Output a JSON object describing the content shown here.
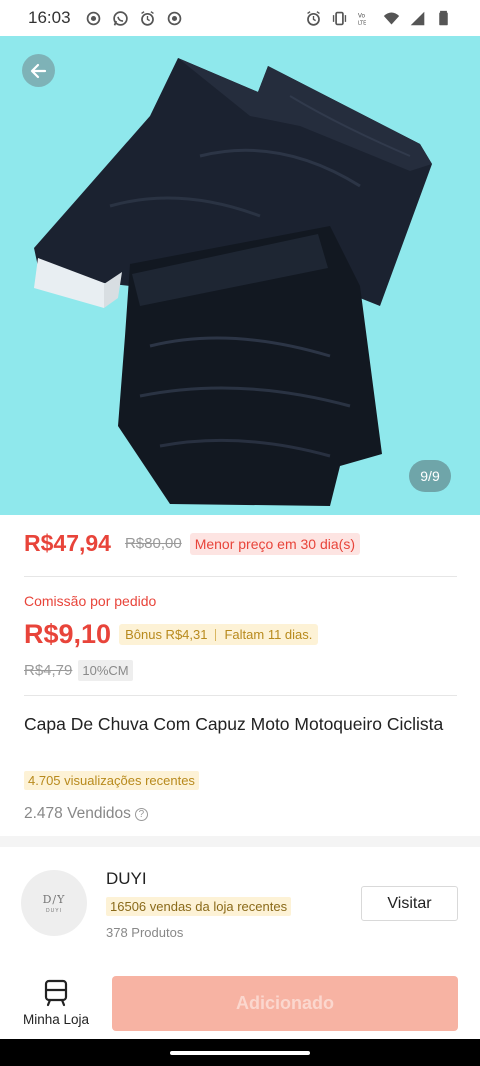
{
  "status_bar": {
    "time": "16:03"
  },
  "hero": {
    "image_counter": "9/9",
    "background_color": "#8fe8ec"
  },
  "price": {
    "current": "R$47,94",
    "original": "R$80,00",
    "badge": "Menor preço em 30 dia(s)"
  },
  "commission": {
    "label": "Comissão por pedido",
    "value": "R$9,10",
    "bonus": "Bônus R$4,31",
    "days_left": "Faltam 11 dias.",
    "old_value": "R$4,79",
    "rate_badge": "10%CM"
  },
  "product": {
    "title": "Capa De Chuva Com Capuz Moto Motoqueiro Ciclista",
    "views_badge": "4.705 visualizações recentes",
    "sold": "2.478 Vendidos"
  },
  "store": {
    "logo_mark": "D/Y",
    "logo_text": "DUYI",
    "name": "DUYI",
    "sales_badge": "16506 vendas da loja recentes",
    "products": "378 Produtos",
    "visit_label": "Visitar"
  },
  "bottom": {
    "my_store_label": "Minha Loja",
    "added_label": "Adicionado"
  },
  "colors": {
    "accent": "#e8443a",
    "bonus": "#b88a1d",
    "added_button": "#f7b3a3"
  },
  "icons": [
    "back-arrow-icon",
    "store-icon",
    "info-icon",
    "wifi-icon",
    "signal-icon",
    "battery-icon",
    "alarm-icon",
    "whatsapp-icon",
    "vibrate-icon"
  ]
}
